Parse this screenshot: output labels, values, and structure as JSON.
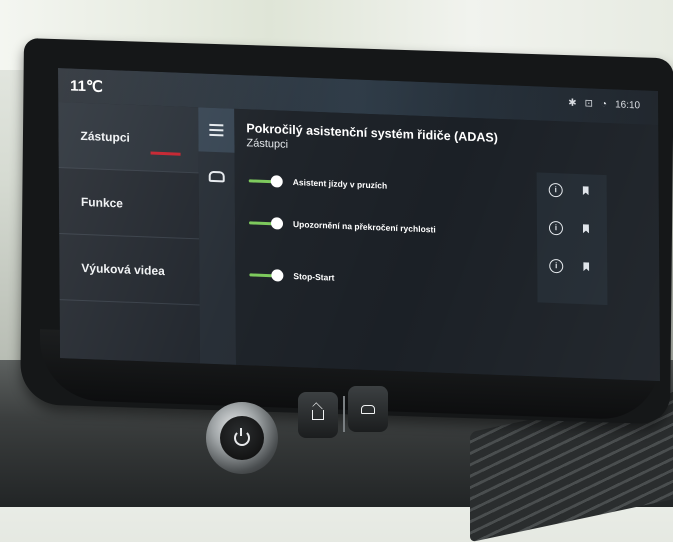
{
  "status": {
    "temperature": "11℃",
    "clock": "16:10",
    "icons": [
      "bluetooth-icon",
      "car-connect-icon",
      "phone-signal-icon"
    ]
  },
  "sidebar": {
    "items": [
      {
        "label": "Zástupci",
        "active": true
      },
      {
        "label": "Funkce",
        "active": false
      },
      {
        "label": "Výuková videa",
        "active": false
      }
    ]
  },
  "rail": {
    "icons": [
      "menu-icon",
      "car-icon"
    ]
  },
  "main": {
    "title": "Pokročilý asistenční systém řidiče (ADAS)",
    "subtitle": "Zástupci",
    "rows": [
      {
        "label": "Asistent jízdy v pruzích",
        "enabled": true
      },
      {
        "label": "Upozornění na překročení rychlosti",
        "enabled": true
      },
      {
        "label": "Stop-Start",
        "enabled": true
      }
    ],
    "info_glyph": "i"
  },
  "colors": {
    "toggle_on": "#7bc95a",
    "active_accent": "#c41e2a",
    "screen_bg": "#1b2027"
  }
}
